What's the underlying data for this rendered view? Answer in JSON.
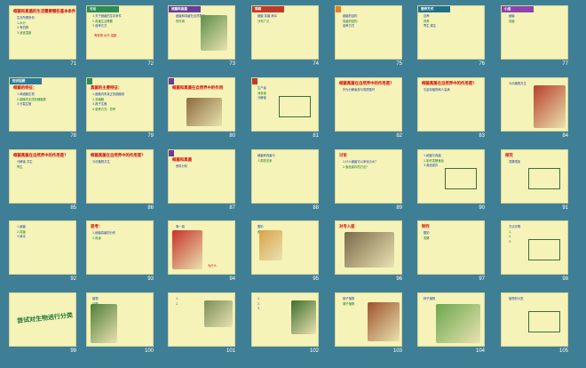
{
  "slides": [
    {
      "num": "71",
      "title": "细菌和真菌的生活需要哪些基本条件？",
      "lines": [
        "生存所需条件：",
        "1.水分",
        "2.有机物",
        "3.适宜温度"
      ]
    },
    {
      "num": "72",
      "header": "讨论",
      "lines": [
        "1.关于细菌的生存条件",
        "2.真菌生活需要",
        "3.营养方式"
      ],
      "extra": "有机物 水分 温度"
    },
    {
      "num": "73",
      "header": "细菌和真菌",
      "lines": [
        "细菌和真菌在自然界中",
        "的作用"
      ]
    },
    {
      "num": "74",
      "header": "观察",
      "lines": [
        "细菌 真菌 病毒",
        "分布广泛"
      ]
    },
    {
      "num": "75",
      "header": "",
      "lines": [
        "细菌的结构",
        "真菌的结构",
        "营养方式"
      ]
    },
    {
      "num": "76",
      "header": "营养方式",
      "lines": [
        "自养",
        "异养",
        "寄生 腐生"
      ]
    },
    {
      "num": "77",
      "header": "小结",
      "lines": [
        "细菌",
        "真菌"
      ]
    },
    {
      "num": "78",
      "header": "知识回顾",
      "title": "细菌的特征：",
      "lines": [
        "1.单细胞生物",
        "2.细胞内无成形细胞核",
        "3.分裂生殖"
      ]
    },
    {
      "num": "79",
      "header": "",
      "title": "真菌的主要特征：",
      "lines": [
        "1.细胞内有真正的细胞核",
        "2.多细胞",
        "3.孢子生殖",
        "4.营养方式：异养"
      ]
    },
    {
      "num": "80",
      "header": "",
      "title": "细菌和真菌在自然界中的作用"
    },
    {
      "num": "81",
      "header": "",
      "lines": [
        "生产者",
        "消费者",
        "分解者"
      ]
    },
    {
      "num": "82",
      "title": "细菌真菌在自然界中的作用是？",
      "lines": [
        "作为分解者参与物质循环"
      ]
    },
    {
      "num": "83",
      "title": "细菌真菌在自然界中的作用是？",
      "lines": [
        "引起动植物和人患病"
      ]
    },
    {
      "num": "84",
      "lines": [
        "与动植物共生"
      ]
    },
    {
      "num": "85",
      "title": "细菌真菌在自然界中的作用是？",
      "lines": [
        "分解者 共生",
        "寄生"
      ]
    },
    {
      "num": "86",
      "title": "细菌真菌在自然界中的作用是？",
      "lines": [
        "与动植物共生"
      ]
    },
    {
      "num": "87",
      "header": "",
      "title": "细菌和真菌",
      "lines": [
        "资料分析"
      ]
    },
    {
      "num": "88",
      "lines": [
        "细菌和真菌与",
        "人类的关系"
      ]
    },
    {
      "num": "89",
      "title": "讨论",
      "lines": [
        "1.什么细菌可以净化污水？",
        "2.食品保存的方法？"
      ]
    },
    {
      "num": "90",
      "lines": [
        "1.细菌与真菌",
        "2.制作发酵食品",
        "3.食品保存"
      ]
    },
    {
      "num": "91",
      "title": "探究",
      "lines": [
        "发酵现象"
      ]
    },
    {
      "num": "92",
      "lines": [
        "1.细菌",
        "2.真菌",
        "3.病毒"
      ]
    },
    {
      "num": "93",
      "title": "思考：",
      "lines": [
        "1.细菌真菌的分布",
        "2.用途"
      ]
    },
    {
      "num": "94",
      "lines": [
        "第一组",
        "第二组"
      ],
      "caption": "为什么"
    },
    {
      "num": "95",
      "lines": [
        "酸奶",
        "面包"
      ]
    },
    {
      "num": "96",
      "title": "对号入座"
    },
    {
      "num": "97",
      "title": "制作",
      "lines": [
        "酸奶",
        "发酵"
      ]
    },
    {
      "num": "98",
      "lines": [
        "方法步骤",
        "1.",
        "2.",
        "3."
      ]
    },
    {
      "num": "99",
      "title": "尝试对生物进行分类"
    },
    {
      "num": "100",
      "lines": [
        "植物",
        "动物"
      ]
    },
    {
      "num": "101",
      "lines": [
        "1.",
        "2."
      ]
    },
    {
      "num": "102",
      "lines": [
        "1.",
        "2.",
        "3."
      ]
    },
    {
      "num": "103",
      "lines": [
        "被子植物",
        "裸子植物"
      ]
    },
    {
      "num": "104",
      "lines": [
        "种子植物"
      ]
    },
    {
      "num": "105",
      "lines": [
        "植物的分类"
      ]
    }
  ]
}
